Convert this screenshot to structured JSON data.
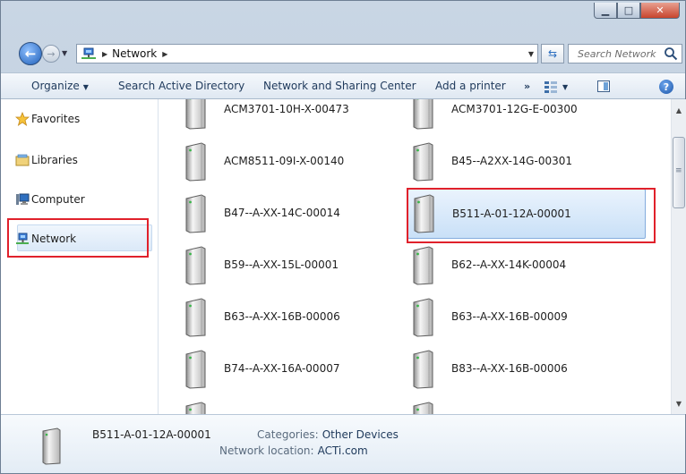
{
  "address": {
    "crumbs": [
      "Network"
    ]
  },
  "search": {
    "placeholder": "Search Network"
  },
  "toolbar": {
    "organize": "Organize",
    "search_ad": "Search Active Directory",
    "network_sharing": "Network and Sharing Center",
    "add_printer": "Add a printer",
    "more": "»"
  },
  "nav": {
    "favorites": "Favorites",
    "libraries": "Libraries",
    "computer": "Computer",
    "network": "Network"
  },
  "items": [
    {
      "label": "ACM3701-10H-X-00473"
    },
    {
      "label": "ACM3701-12G-E-00300"
    },
    {
      "label": "ACM8511-09I-X-00140"
    },
    {
      "label": "B45--A2XX-14G-00301"
    },
    {
      "label": "B47--A-XX-14C-00014"
    },
    {
      "label": "B511-A-01-12A-00001",
      "selected": true
    },
    {
      "label": "B59--A-XX-15L-00001"
    },
    {
      "label": "B62--A-XX-14K-00004"
    },
    {
      "label": "B63--A-XX-16B-00006"
    },
    {
      "label": "B63--A-XX-16B-00009"
    },
    {
      "label": "B74--A-XX-16A-00007"
    },
    {
      "label": "B83--A-XX-16B-00006"
    }
  ],
  "details": {
    "name": "B511-A-01-12A-00001",
    "categories_label": "Categories:",
    "categories_value": "Other Devices",
    "location_label": "Network location:",
    "location_value": "ACTi.com"
  },
  "colors": {
    "highlight": "#e0212b",
    "selection": "#84acdd",
    "link": "#1e395b"
  },
  "icons": {
    "server": "server-icon",
    "network": "network-icon"
  }
}
